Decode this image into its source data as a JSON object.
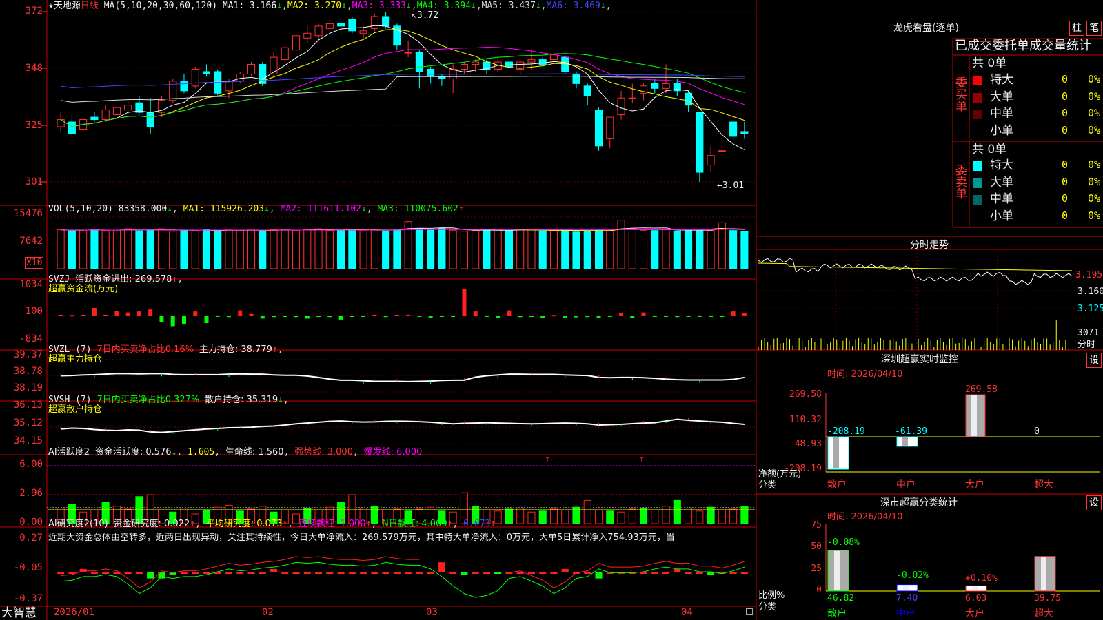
{
  "stock": {
    "star": "★",
    "name": "天地源",
    "period": "日线"
  },
  "brand": "大智慧",
  "price_axis": [
    "3.72",
    "3.48",
    "3.25",
    "3.01"
  ],
  "price_axis_display": [
    "372",
    "348",
    "325",
    "301"
  ],
  "hi_label": "3.72",
  "lo_label": "3.01",
  "ma_legend": {
    "title": "MA(5,10,20,30,60,120)",
    "items": [
      {
        "label": "MA1: 3.166",
        "arrow": "↓",
        "color": "#ffffff"
      },
      {
        "label": "MA2: 3.270",
        "arrow": "↓",
        "color": "#ffff00"
      },
      {
        "label": "MA3: 3.333",
        "arrow": "↓",
        "color": "#ff00ff"
      },
      {
        "label": "MA4: 3.394",
        "arrow": "↓",
        "color": "#00ff00"
      },
      {
        "label": "MA5: 3.437",
        "arrow": "↓",
        "color": "#dddddd"
      },
      {
        "label": "MA6: 3.469",
        "arrow": "↓",
        "color": "#4444ff"
      }
    ]
  },
  "vol_legend": {
    "title": "VOL(5,10,20)",
    "value": "83358.000",
    "ma1": "MA1: 115926.203",
    "ma2": "MA2: 111611.102",
    "ma3": "MA3: 110075.602",
    "axis": [
      "15476",
      "7642",
      "X10"
    ]
  },
  "svzj": {
    "title": "SVZJ",
    "label": "活跃资金进出: 269.578",
    "sub": "超赢资金流(万元)",
    "axis": [
      "1034",
      "100",
      "-834"
    ]
  },
  "svzl": {
    "title": "SVZL (7)",
    "pct": "7日内买卖净占比0.16%",
    "hold": "主力持仓: 38.779",
    "sub": "超赢主力持仓",
    "axis": [
      "39.37",
      "38.78",
      "38.19"
    ]
  },
  "svsh": {
    "title": "SVSH (7)",
    "pct": "7日内买卖净占比0.327%",
    "hold": "散户持仓: 35.319",
    "sub": "超赢散户持仓",
    "axis": [
      "36.13",
      "35.12",
      "34.15"
    ]
  },
  "ai1": {
    "title": "AI活跃度2",
    "a": "资金活跃度: 0.576",
    "b": "1.605",
    "c": "生命线: 1.560",
    "d": "强势线: 3.000",
    "e": "爆发线: 6.000",
    "axis": [
      "6.00",
      "2.96",
      "0.00"
    ]
  },
  "ai2": {
    "title": "AI研究度2(10)",
    "a": "资金研究度: 0.022",
    "b": "平均研究度: 0.073",
    "c": "连续飘红: 1.000",
    "d": "N日飘红: 4.000",
    "e": "0.073",
    "note": "近期大资金总体由空转多，近两日出现异动，关注其持续性，今日大单净流入：269.579万元，其中特大单净流入：0万元，大单5日累计净入754.93万元，当",
    "axis": [
      "0.27",
      "-0.05",
      "-0.37"
    ]
  },
  "dates": [
    "2026/01",
    "02",
    "03",
    "04"
  ],
  "lhb": {
    "title": "龙虎看盘(逐单)",
    "btn1": "柱",
    "btn2": "笔",
    "header": "已成交委托单成交量统计",
    "buy_label": "委买单",
    "sell_label": "委卖单",
    "buy_total": "共 0单",
    "sell_total": "共 0单",
    "buy_rows": [
      {
        "name": "特大",
        "val": "0",
        "pct": "0%",
        "color": "#ff0000"
      },
      {
        "name": "大单",
        "val": "0",
        "pct": "0%",
        "color": "#990000"
      },
      {
        "name": "中单",
        "val": "0",
        "pct": "0%",
        "color": "#660000"
      },
      {
        "name": "小单",
        "val": "0",
        "pct": "0%",
        "color": ""
      }
    ],
    "sell_rows": [
      {
        "name": "特大",
        "val": "0",
        "pct": "0%",
        "color": "#00ffff"
      },
      {
        "name": "大单",
        "val": "0",
        "pct": "0%",
        "color": "#009999"
      },
      {
        "name": "中单",
        "val": "0",
        "pct": "0%",
        "color": "#006666"
      },
      {
        "name": "小单",
        "val": "0",
        "pct": "0%",
        "color": ""
      }
    ]
  },
  "fenshi": {
    "title": "分时走势",
    "axis": [
      "3.195",
      "3.160",
      "3.125"
    ],
    "vol": "3071",
    "vol_label": "分时"
  },
  "monitor": {
    "title": "深圳超赢实时监控",
    "btn": "设",
    "time": "时间: 2026/04/10",
    "axis": [
      "269.58",
      "110.32",
      "-48.93",
      "-208.19"
    ],
    "ylabel": "净额(万元)",
    "xlabel": "分类",
    "cats": [
      "散户",
      "中户",
      "大户",
      "超大"
    ],
    "values": [
      -208.19,
      -61.39,
      269.58,
      0
    ],
    "value_labels": [
      "-208.19",
      "-61.39",
      "269.58",
      "0"
    ]
  },
  "classify": {
    "title": "深市超赢分类统计",
    "btn": "设",
    "time": "时间: 2026/04/10",
    "axis": [
      "75",
      "50",
      "25",
      "0"
    ],
    "ylabel": "比例%",
    "xlabel": "分类",
    "cats": [
      "散户",
      "中户",
      "大户",
      "超大"
    ],
    "values": [
      46.82,
      7.4,
      6.03,
      39.75
    ],
    "value_labels": [
      "46.82",
      "7.40",
      "6.03",
      "39.75"
    ],
    "changes": [
      "-0.08%",
      "-0.02%",
      "+0.10%",
      ""
    ]
  },
  "chart_data": {
    "type": "candlestick",
    "candles": [
      [
        3.24,
        3.3,
        3.22,
        3.27
      ],
      [
        3.26,
        3.29,
        3.2,
        3.21
      ],
      [
        3.23,
        3.28,
        3.22,
        3.27
      ],
      [
        3.28,
        3.3,
        3.26,
        3.27
      ],
      [
        3.27,
        3.33,
        3.26,
        3.31
      ],
      [
        3.29,
        3.34,
        3.28,
        3.32
      ],
      [
        3.31,
        3.35,
        3.29,
        3.33
      ],
      [
        3.34,
        3.37,
        3.29,
        3.3
      ],
      [
        3.3,
        3.36,
        3.21,
        3.24
      ],
      [
        3.3,
        3.37,
        3.28,
        3.35
      ],
      [
        3.35,
        3.44,
        3.34,
        3.43
      ],
      [
        3.43,
        3.46,
        3.38,
        3.39
      ],
      [
        3.41,
        3.49,
        3.4,
        3.48
      ],
      [
        3.47,
        3.5,
        3.45,
        3.46
      ],
      [
        3.47,
        3.48,
        3.37,
        3.38
      ],
      [
        3.39,
        3.44,
        3.36,
        3.43
      ],
      [
        3.43,
        3.47,
        3.42,
        3.46
      ],
      [
        3.46,
        3.51,
        3.45,
        3.5
      ],
      [
        3.5,
        3.51,
        3.41,
        3.42
      ],
      [
        3.46,
        3.55,
        3.45,
        3.53
      ],
      [
        3.52,
        3.58,
        3.51,
        3.57
      ],
      [
        3.56,
        3.64,
        3.55,
        3.62
      ],
      [
        3.61,
        3.66,
        3.59,
        3.63
      ],
      [
        3.62,
        3.67,
        3.6,
        3.66
      ],
      [
        3.65,
        3.69,
        3.63,
        3.67
      ],
      [
        3.67,
        3.69,
        3.62,
        3.66
      ],
      [
        3.69,
        3.7,
        3.63,
        3.64
      ],
      [
        3.63,
        3.66,
        3.61,
        3.64
      ],
      [
        3.65,
        3.71,
        3.64,
        3.7
      ],
      [
        3.7,
        3.72,
        3.65,
        3.66
      ],
      [
        3.66,
        3.67,
        3.56,
        3.58
      ],
      [
        3.55,
        3.6,
        3.53,
        3.55
      ],
      [
        3.55,
        3.56,
        3.4,
        3.47
      ],
      [
        3.48,
        3.49,
        3.42,
        3.45
      ],
      [
        3.45,
        3.46,
        3.41,
        3.44
      ],
      [
        3.44,
        3.5,
        3.38,
        3.48
      ],
      [
        3.48,
        3.51,
        3.46,
        3.5
      ],
      [
        3.5,
        3.52,
        3.47,
        3.51
      ],
      [
        3.51,
        3.52,
        3.46,
        3.48
      ],
      [
        3.48,
        3.53,
        3.47,
        3.51
      ],
      [
        3.51,
        3.53,
        3.48,
        3.49
      ],
      [
        3.48,
        3.52,
        3.46,
        3.51
      ],
      [
        3.51,
        3.56,
        3.48,
        3.52
      ],
      [
        3.52,
        3.53,
        3.5,
        3.5
      ],
      [
        3.52,
        3.6,
        3.49,
        3.54
      ],
      [
        3.53,
        3.54,
        3.46,
        3.47
      ],
      [
        3.46,
        3.47,
        3.4,
        3.42
      ],
      [
        3.41,
        3.42,
        3.33,
        3.37
      ],
      [
        3.31,
        3.32,
        3.14,
        3.16
      ],
      [
        3.19,
        3.28,
        3.15,
        3.28
      ],
      [
        3.29,
        3.39,
        3.27,
        3.36
      ],
      [
        3.36,
        3.42,
        3.34,
        3.36
      ],
      [
        3.38,
        3.42,
        3.35,
        3.41
      ],
      [
        3.42,
        3.44,
        3.38,
        3.4
      ],
      [
        3.4,
        3.5,
        3.38,
        3.42
      ],
      [
        3.42,
        3.44,
        3.37,
        3.39
      ],
      [
        3.38,
        3.39,
        3.3,
        3.33
      ],
      [
        3.3,
        3.3,
        3.01,
        3.05
      ],
      [
        3.08,
        3.16,
        3.05,
        3.12
      ],
      [
        3.14,
        3.17,
        3.13,
        3.14
      ],
      [
        3.26,
        3.27,
        3.18,
        3.2
      ],
      [
        3.22,
        3.26,
        3.19,
        3.21
      ]
    ],
    "ma_lines": "MA(5,10,20,30,60,120)",
    "ylim": [
      3.01,
      3.72
    ],
    "volume_x10": [
      10900,
      10700,
      10800,
      11100,
      10700,
      10800,
      11200,
      10600,
      10900,
      11200,
      10500,
      10700,
      10700,
      11000,
      10600,
      10900,
      10800,
      10900,
      10600,
      11000,
      11100,
      10600,
      11000,
      11200,
      10700,
      10800,
      11100,
      10600,
      10900,
      10600,
      10900,
      13200,
      11200,
      10800,
      11300,
      10800,
      10500,
      10700,
      10900,
      11000,
      10700,
      11000,
      10900,
      10600,
      10700,
      10700,
      10300,
      10400,
      10900,
      10800,
      13600,
      11300,
      10700,
      10700,
      11000,
      10600,
      11000,
      10800,
      10700,
      12900,
      10700,
      10500
    ],
    "svzj_values": [
      0,
      20,
      0,
      300,
      0,
      180,
      120,
      160,
      240,
      -260,
      -420,
      -340,
      160,
      -300,
      -40,
      -60,
      200,
      60,
      -120,
      -60,
      -40,
      -60,
      -120,
      -40,
      -60,
      -160,
      -20,
      -40,
      30,
      -60,
      0,
      30,
      -30,
      -80,
      -20,
      -50,
      1034,
      160,
      -20,
      -80,
      200,
      -60,
      -40,
      -100,
      20,
      -80,
      -70,
      -60,
      -80,
      -30,
      100,
      -100,
      120,
      -20,
      -40,
      -60,
      -50,
      -30,
      -30,
      -40,
      160,
      80
    ]
  }
}
